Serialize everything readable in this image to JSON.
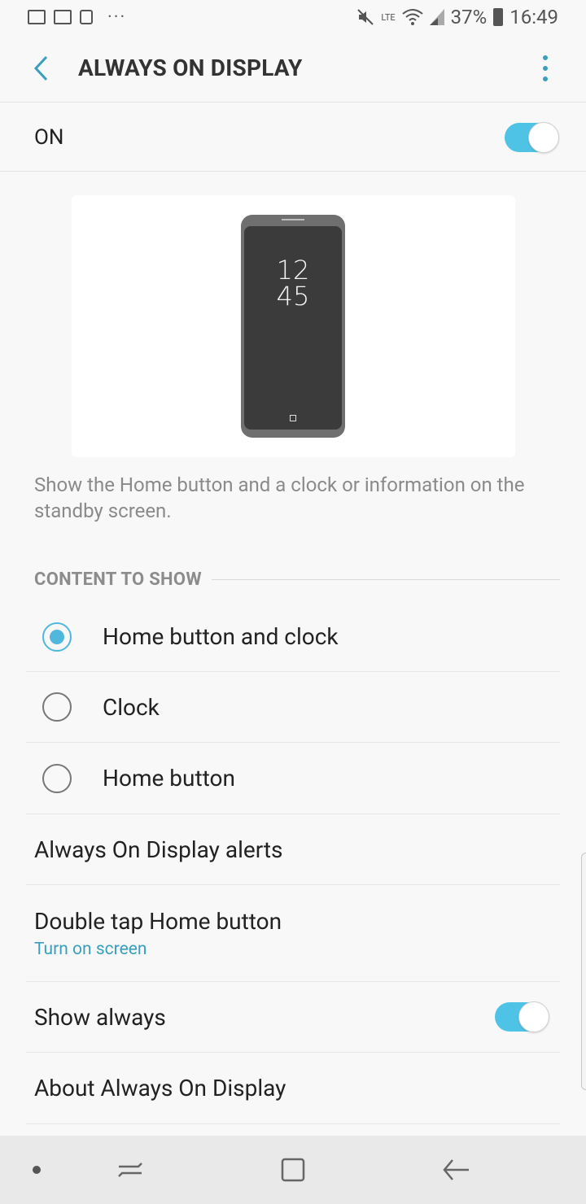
{
  "status_bar": {
    "battery": "37%",
    "time": "16:49",
    "dots": "···",
    "network": "LTE"
  },
  "header": {
    "title": "ALWAYS ON DISPLAY"
  },
  "master_switch": {
    "label": "ON",
    "state": "on"
  },
  "preview": {
    "clock_hour": "12",
    "clock_minute": "45"
  },
  "description": "Show the Home button and a clock or information on the standby screen.",
  "content_section": {
    "title": "CONTENT TO SHOW",
    "options": [
      {
        "label": "Home button and clock",
        "selected": true
      },
      {
        "label": "Clock",
        "selected": false
      },
      {
        "label": "Home button",
        "selected": false
      }
    ]
  },
  "settings": {
    "alerts_label": "Always On Display alerts",
    "double_tap_label": "Double tap Home button",
    "double_tap_value": "Turn on screen",
    "show_always_label": "Show always",
    "show_always_state": "on",
    "about_label": "About Always On Display"
  },
  "colors": {
    "accent": "#4fc3e6",
    "link": "#3a9fbf"
  }
}
